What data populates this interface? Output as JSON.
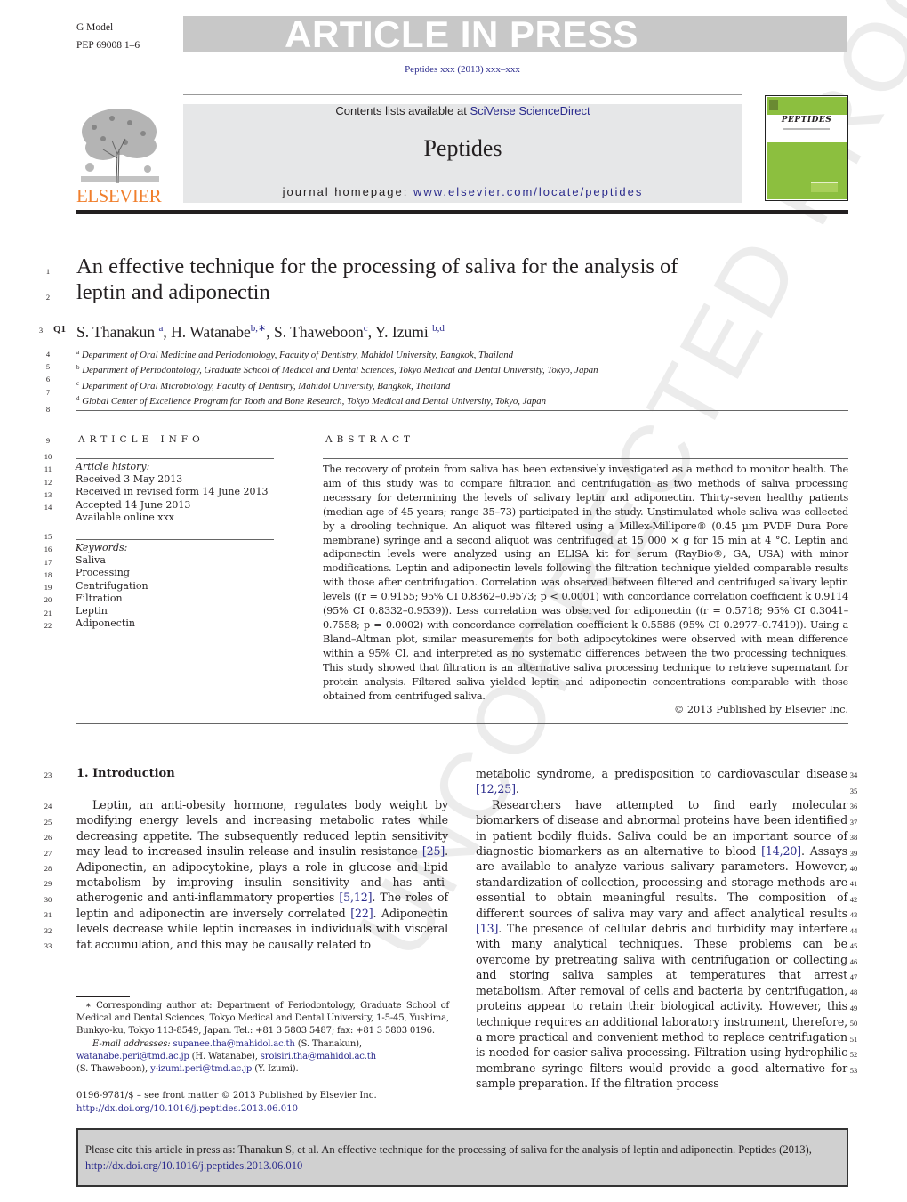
{
  "banner": {
    "model_line1": "G Model",
    "model_line2": "PEP 69008 1–6",
    "status": "ARTICLE IN PRESS",
    "journal_ref": "Peptides xxx (2013) xxx–xxx"
  },
  "header": {
    "publisher_logo_text": "ELSEVIER",
    "contents_prefix": "Contents lists available at ",
    "contents_link": "SciVerse ScienceDirect",
    "journal_name": "Peptides",
    "homepage_prefix": "journal homepage: ",
    "homepage_link": "www.elsevier.com/locate/peptides",
    "cover_title": "PEPTIDES",
    "colors": {
      "brand_orange": "#f07f2d",
      "cover_green": "#8cbf3f",
      "link_blue": "#2a2a8c",
      "header_gray": "#e6e7e8"
    }
  },
  "watermark": "UNCORRECTED PROOF",
  "article": {
    "title_line1": "An effective technique for the processing of saliva for the analysis of",
    "title_line2": "leptin and adiponectin",
    "query_marker": "Q1",
    "authors": [
      {
        "name": "S. Thanakun",
        "sup": "a"
      },
      {
        "name": "H. Watanabe",
        "sup": "b,∗"
      },
      {
        "name": "S. Thaweboon",
        "sup": "c"
      },
      {
        "name": "Y. Izumi",
        "sup": "b,d"
      }
    ],
    "affiliations": [
      {
        "sup": "a",
        "text": "Department of Oral Medicine and Periodontology, Faculty of Dentistry, Mahidol University, Bangkok, Thailand"
      },
      {
        "sup": "b",
        "text": "Department of Periodontology, Graduate School of Medical and Dental Sciences, Tokyo Medical and Dental University, Tokyo, Japan"
      },
      {
        "sup": "c",
        "text": "Department of Oral Microbiology, Faculty of Dentistry, Mahidol University, Bangkok, Thailand"
      },
      {
        "sup": "d",
        "text": "Global Center of Excellence Program for Tooth and Bone Research, Tokyo Medical and Dental University, Tokyo, Japan"
      }
    ]
  },
  "article_info": {
    "heading": "ARTICLE INFO",
    "history_label": "Article history:",
    "history": [
      "Received 3 May 2013",
      "Received in revised form 14 June 2013",
      "Accepted 14 June 2013",
      "Available online xxx"
    ],
    "keywords_label": "Keywords:",
    "keywords": [
      "Saliva",
      "Processing",
      "Centrifugation",
      "Filtration",
      "Leptin",
      "Adiponectin"
    ]
  },
  "abstract": {
    "heading": "ABSTRACT",
    "text": "The recovery of protein from saliva has been extensively investigated as a method to monitor health. The aim of this study was to compare filtration and centrifugation as two methods of saliva processing necessary for determining the levels of salivary leptin and adiponectin. Thirty-seven healthy patients (median age of 45 years; range 35–73) participated in the study. Unstimulated whole saliva was collected by a drooling technique. An aliquot was filtered using a Millex-Millipore® (0.45 µm PVDF Dura Pore membrane) syringe and a second aliquot was centrifuged at 15 000 × g for 15 min at 4 °C. Leptin and adiponectin levels were analyzed using an ELISA kit for serum (RayBio®, GA, USA) with minor modifications. Leptin and adiponectin levels following the filtration technique yielded comparable results with those after centrifugation. Correlation was observed between filtered and centrifuged salivary leptin levels ((r = 0.9155; 95% CI 0.8362–0.9573; p < 0.0001) with concordance correlation coefficient k 0.9114 (95% CI 0.8332–0.9539)). Less correlation was observed for adiponectin ((r = 0.5718; 95% CI 0.3041–0.7558; p = 0.0002) with concordance correlation coefficient k 0.5586 (95% CI 0.2977–0.7419)). Using a Bland–Altman plot, similar measurements for both adipocytokines were observed with mean difference within a 95% CI, and interpreted as no systematic differences between the two processing techniques. This study showed that filtration is an alternative saliva processing technique to retrieve supernatant for protein analysis. Filtered saliva yielded leptin and adiponectin concentrations comparable with those obtained from centrifuged saliva.",
    "copyright": "© 2013 Published by Elsevier Inc."
  },
  "introduction": {
    "heading": "1.  Introduction",
    "left_segments": [
      "Leptin, an anti-obesity hormone, regulates body weight by modifying energy levels and increasing metabolic rates while decreasing appetite. The subsequently reduced leptin sensitivity may lead to increased insulin release and insulin resistance ",
      "[25]",
      ". Adiponectin, an adipocytokine, plays a role in glucose and lipid metabolism by improving insulin sensitivity and has anti-atherogenic and anti-inflammatory properties ",
      "[5,12]",
      ". The roles of leptin and adiponectin are inversely correlated ",
      "[22]",
      ". Adiponectin levels decrease while leptin increases in individuals with visceral fat accumulation, and this may be causally related to"
    ],
    "right_p1_text": "metabolic syndrome, a predisposition to cardiovascular disease ",
    "right_p1_ref": "[12,25]",
    "right_p2_segments": [
      "Researchers have attempted to find early molecular biomarkers of disease and abnormal proteins have been identified in patient bodily fluids. Saliva could be an important source of diagnostic biomarkers as an alternative to blood ",
      "[14,20]",
      ". Assays are available to analyze various salivary parameters. However, standardization of collection, processing and storage methods are essential to obtain meaningful results. The composition of different sources of saliva may vary and affect analytical results ",
      "[13]",
      ". The presence of cellular debris and turbidity may interfere with many analytical techniques. These problems can be overcome by pretreating saliva with centrifugation or collecting and storing saliva samples at temperatures that arrest metabolism. After removal of cells and bacteria by centrifugation, proteins appear to retain their biological activity. However, this technique requires an additional laboratory instrument, therefore, a more practical and convenient method to replace centrifugation is needed for easier saliva processing. Filtration using hydrophilic membrane syringe filters would provide a good alternative for sample preparation. If the filtration process"
    ]
  },
  "footnote": {
    "corresponding": "∗ Corresponding author at: Department of Periodontology, Graduate School of Medical and Dental Sciences, Tokyo Medical and Dental University, 1-5-45, Yushima, Bunkyo-ku, Tokyo 113-8549, Japan. Tel.: +81 3 5803 5487; fax: +81 3 5803 0196.",
    "email_label": "E-mail addresses:",
    "emails": [
      {
        "address": "supanee.tha@mahidol.ac.th",
        "owner": "(S. Thanakun),"
      },
      {
        "address": "watanabe.peri@tmd.ac.jp",
        "owner": "(H. Watanabe),"
      },
      {
        "address": "sroisiri.tha@mahidol.ac.th",
        "owner": "(S. Thaweboon),"
      },
      {
        "address": "y-izumi.peri@tmd.ac.jp",
        "owner": "(Y. Izumi)."
      }
    ],
    "issn": "0196-9781/$ – see front matter © 2013 Published by Elsevier Inc.",
    "doi": "http://dx.doi.org/10.1016/j.peptides.2013.06.010"
  },
  "citation_box": {
    "text": "Please cite this article in press as: Thanakun S, et al. An effective technique for the processing of saliva for the analysis of leptin and adiponectin. Peptides (2013), ",
    "doi": "http://dx.doi.org/10.1016/j.peptides.2013.06.010"
  },
  "line_numbers": {
    "left": [
      "1",
      "2",
      "3",
      "4",
      "5",
      "6",
      "7",
      "8",
      "9",
      "10",
      "11",
      "12",
      "13",
      "14",
      "15",
      "16",
      "17",
      "18",
      "19",
      "20",
      "21",
      "22",
      "23",
      "24",
      "25",
      "26",
      "27",
      "28",
      "29",
      "30",
      "31",
      "32",
      "33"
    ],
    "right": [
      "34",
      "35",
      "36",
      "37",
      "38",
      "39",
      "40",
      "41",
      "42",
      "43",
      "44",
      "45",
      "46",
      "47",
      "48",
      "49",
      "50",
      "51",
      "52",
      "53"
    ]
  }
}
